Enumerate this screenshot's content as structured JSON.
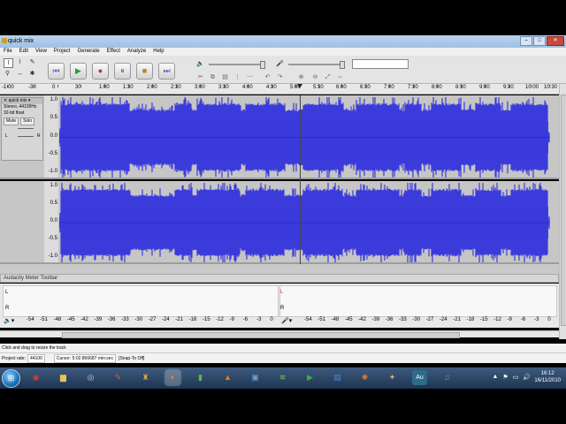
{
  "window": {
    "title": "quick mix"
  },
  "menu": [
    "File",
    "Edit",
    "View",
    "Project",
    "Generate",
    "Effect",
    "Analyze",
    "Help"
  ],
  "toolbar": {
    "tools": [
      {
        "name": "selection-tool-icon",
        "glyph": "I"
      },
      {
        "name": "envelope-tool-icon",
        "glyph": "⌇"
      },
      {
        "name": "draw-tool-icon",
        "glyph": "✎"
      },
      {
        "name": "zoom-tool-icon",
        "glyph": "⚲"
      },
      {
        "name": "timeshift-tool-icon",
        "glyph": "↔"
      },
      {
        "name": "multi-tool-icon",
        "glyph": "✱"
      }
    ],
    "transport": [
      {
        "name": "skip-start-button",
        "glyph": "⏮",
        "color": "#5566cc"
      },
      {
        "name": "play-button",
        "glyph": "▶",
        "color": "#2a9a2a"
      },
      {
        "name": "record-button",
        "glyph": "●",
        "color": "#b53a3a"
      },
      {
        "name": "pause-button",
        "glyph": "⏸",
        "color": "#5566cc"
      },
      {
        "name": "stop-button",
        "glyph": "■",
        "color": "#c87a2a"
      },
      {
        "name": "skip-end-button",
        "glyph": "⏭",
        "color": "#5566cc"
      }
    ],
    "speaker_icon": "🔈",
    "mic_icon": "🎤"
  },
  "ruler": {
    "labels": [
      "-1:00",
      "-30",
      "0",
      "30",
      "1:00",
      "1:30",
      "2:00",
      "2:30",
      "3:00",
      "3:30",
      "4:00",
      "4:30",
      "5:00",
      "5:30",
      "6:00",
      "6:30",
      "7:00",
      "7:30",
      "8:00",
      "8:30",
      "9:00",
      "9:30",
      "10:00",
      "10:30"
    ]
  },
  "tracks": [
    {
      "name": "quick mix",
      "info": [
        "Stereo, 44100Hz",
        "32-bit float"
      ],
      "mute": "Mute",
      "solo": "Solo",
      "gain_left": "L",
      "gain_right": "R",
      "amp_labels": [
        "1.0",
        "0.5",
        "0.0",
        "-0.5",
        "-1.0"
      ]
    },
    {
      "amp_labels": [
        "1.0",
        "0.5",
        "0.0",
        "-0.5",
        "-1.0"
      ]
    }
  ],
  "colors": {
    "waveform": "#3b3bdc",
    "waveform_dark": "#1e1ea8",
    "track_bg": "#c6c6c6"
  },
  "meter": {
    "title": "Audacity Meter Toolbar",
    "channel_left": "L",
    "channel_right": "R",
    "scale": [
      "-54",
      "-51",
      "-48",
      "-45",
      "-42",
      "-39",
      "-36",
      "-33",
      "-30",
      "-27",
      "-24",
      "-21",
      "-18",
      "-15",
      "-12",
      "-9",
      "-6",
      "-3",
      "0"
    ]
  },
  "status": {
    "hint": "Click and drag to resize the track",
    "project_rate_label": "Project rate:",
    "project_rate": "44100",
    "cursor": "Cursor: 5:02.866687 min:sec",
    "snap": "[Snap-To Off]"
  },
  "taskbar": {
    "start": "⊞",
    "apps": [
      {
        "name": "chrome-icon",
        "glyph": "◉",
        "color": "#d23f31"
      },
      {
        "name": "explorer-folder-icon",
        "glyph": "▆",
        "color": "#e8c25a"
      },
      {
        "name": "media-player-icon",
        "glyph": "◎",
        "color": "#d0d0d0"
      },
      {
        "name": "paint-icon",
        "glyph": "✎",
        "color": "#e05a3a"
      },
      {
        "name": "installer-icon",
        "glyph": "♜",
        "color": "#d9a440"
      },
      {
        "name": "audacity-icon",
        "glyph": "◐",
        "color": "#f08a24",
        "active": true
      },
      {
        "name": "green-app-icon",
        "glyph": "▮",
        "color": "#5dbb3b"
      },
      {
        "name": "vlc-icon",
        "glyph": "▲",
        "color": "#f07a1a"
      },
      {
        "name": "display-settings-icon",
        "glyph": "▣",
        "color": "#6aa0d8"
      },
      {
        "name": "equalizer-icon",
        "glyph": "≋",
        "color": "#6ecf4a"
      },
      {
        "name": "media-app-icon",
        "glyph": "▶",
        "color": "#3ab23a"
      },
      {
        "name": "network-app-icon",
        "glyph": "▤",
        "color": "#4a8ad8"
      },
      {
        "name": "fox-app-icon",
        "glyph": "✺",
        "color": "#e0782a"
      },
      {
        "name": "bird-app-icon",
        "glyph": "✦",
        "color": "#d8b460"
      },
      {
        "name": "adobe-audition-icon",
        "glyph": "Au",
        "color": "#2e6b8a"
      },
      {
        "name": "music-app-icon",
        "glyph": "♫",
        "color": "#8a8a8a"
      }
    ],
    "tray": [
      "▲",
      "⚑",
      "▭",
      "🔊"
    ],
    "time": "16:12",
    "date": "16/11/2010"
  }
}
